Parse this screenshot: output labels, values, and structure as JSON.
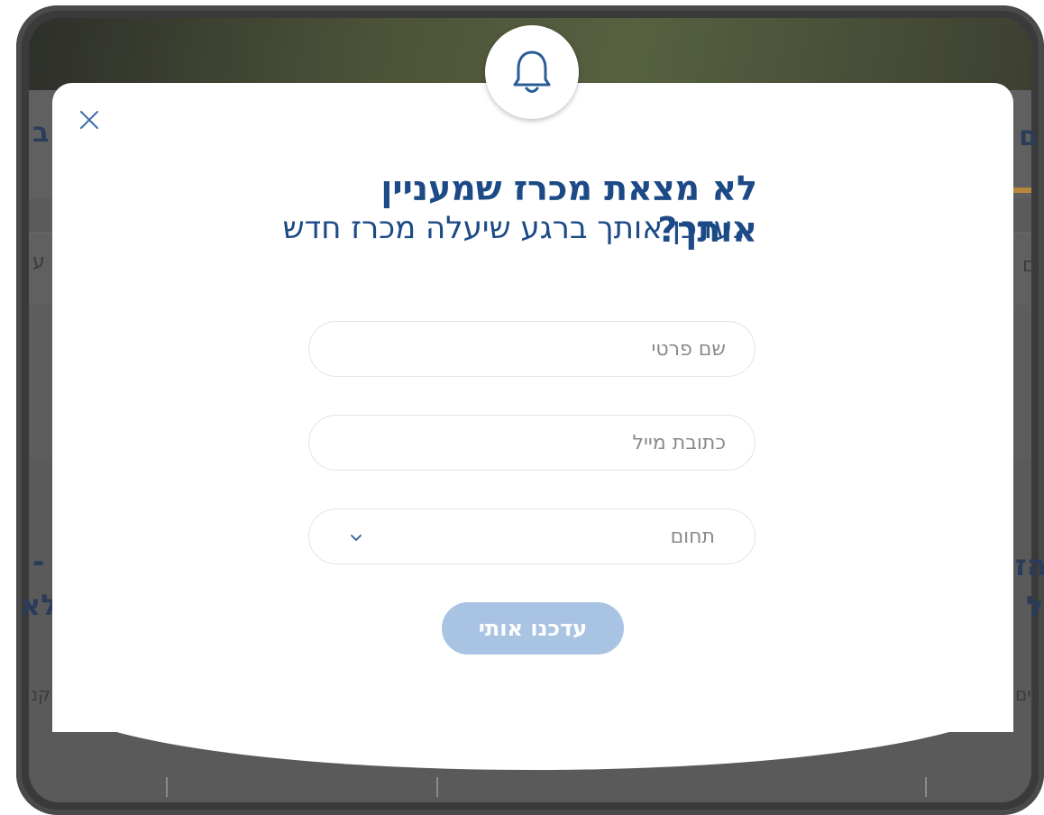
{
  "background_page": {
    "fragments": {
      "left_tab": "ב",
      "right_tab": "ם",
      "left_row": "ע",
      "right_row": "ם",
      "left_heading_1": "-",
      "left_heading_2": "לא",
      "right_heading_1": "הז",
      "right_heading_2": "ל",
      "left_note": "קנ",
      "right_note": "נים"
    }
  },
  "modal": {
    "title": "לא מצאת מכרז שמעניין אותך?",
    "subtitle": "נעדכן אותך ברגע שיעלה מכרז חדש",
    "fields": {
      "name_placeholder": "שם פרטי",
      "email_placeholder": "כתובת מייל",
      "category_label": "תחום"
    },
    "submit_label": "עדכנו אותי"
  },
  "colors": {
    "title": "#1c4a86",
    "submit_bg": "#a9c4e3",
    "field_border": "#e3e3e3"
  },
  "icons": {
    "badge": "bell-icon",
    "close": "close-icon",
    "select": "chevron-down-icon"
  }
}
